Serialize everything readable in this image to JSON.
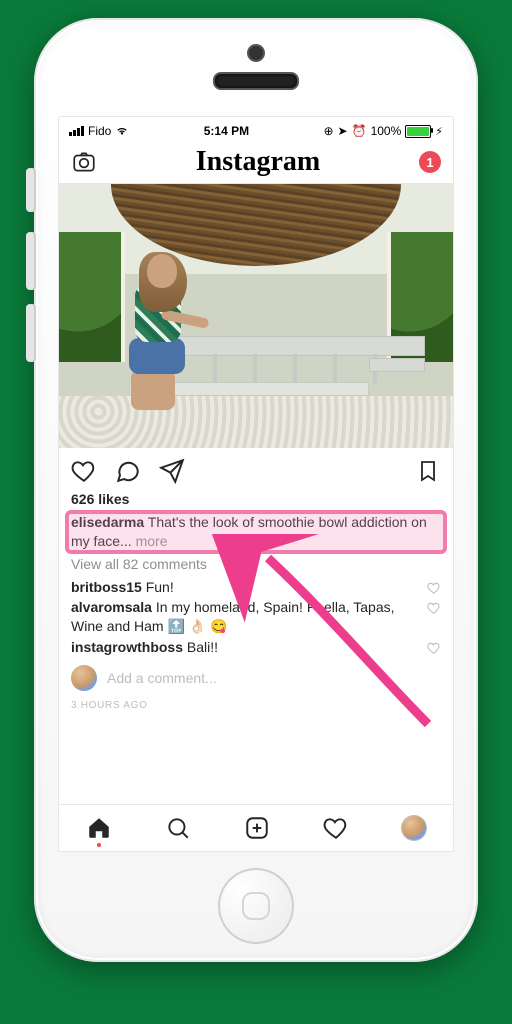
{
  "status": {
    "carrier": "Fido",
    "time": "5:14 PM",
    "battery": "100%"
  },
  "header": {
    "title": "Instagram",
    "direct_badge": "1"
  },
  "post": {
    "likes": "626 likes",
    "caption_user": "elisedarma",
    "caption_text": " That's the look of smoothie bowl addiction on my face... ",
    "more_label": "more",
    "view_all": "View all 82 comments",
    "comments": [
      {
        "user": "britboss15",
        "text": " Fun!"
      },
      {
        "user": "alvaromsala",
        "text": " In my homeland, Spain! Paella, Tapas, Wine and Ham 🔝 👌🏻 😋"
      },
      {
        "user": "instagrowthboss",
        "text": " Bali!!"
      }
    ],
    "add_comment_placeholder": "Add a comment...",
    "timestamp": "3 HOURS AGO"
  }
}
